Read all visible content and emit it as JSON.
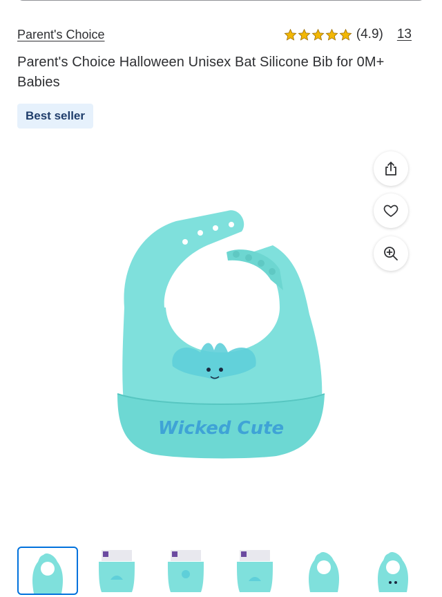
{
  "product": {
    "brand": "Parent's Choice",
    "rating": "(4.9)",
    "review_count": "13",
    "title": "Parent's Choice Halloween Unisex Bat Silicone Bib for 0M+ Babies",
    "badge": "Best seller",
    "image_text": "Wicked Cute",
    "star_count": 5,
    "thumbnail_count": 6,
    "selected_thumbnail": 1
  },
  "actions": [
    {
      "icon": "share-icon"
    },
    {
      "icon": "heart-icon"
    },
    {
      "icon": "zoom-in-icon"
    }
  ],
  "colors": {
    "star": "#f2b705",
    "bib": "#7fe0dc",
    "bib_dark": "#5fd0cb",
    "badge_bg": "#e6f1fc",
    "badge_text": "#1f3d6b",
    "selected_border": "#0071dc"
  }
}
